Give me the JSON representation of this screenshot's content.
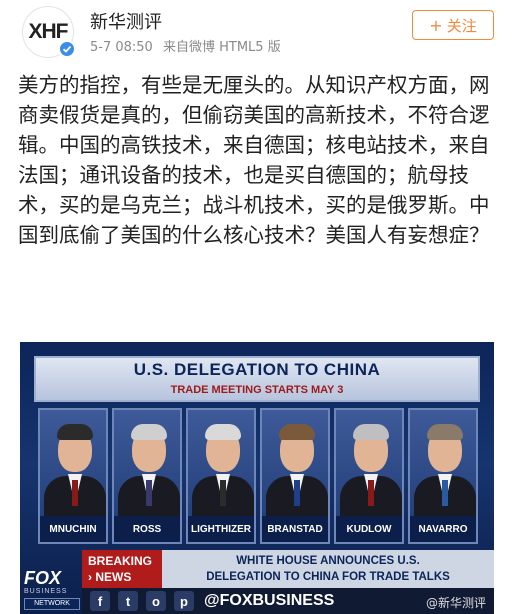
{
  "header": {
    "avatar_text": "XHF",
    "user_name": "新华测评",
    "post_time": "5-7 08:50",
    "post_source": "来自微博 HTML5 版",
    "follow_label": "关注",
    "follow_icon": "plus-icon"
  },
  "post": {
    "text": "美方的指控，有些是无厘头的。从知识产权方面，网商卖假货是真的，但偷窃美国的高新技术，不符合逻辑。中国的高铁技术，来自德国；核电站技术，来自法国；通讯设备的技术，也是买自德国的；航母技术，买的是乌克兰；战斗机技术，买的是俄罗斯。中国到底偷了美国的什么核心技术？美国人有妄想症？"
  },
  "news_image": {
    "banner_title": "U.S. DELEGATION TO CHINA",
    "banner_subtitle": "TRADE MEETING STARTS MAY 3",
    "delegates": [
      {
        "name": "MNUCHIN",
        "hair": "#2b2b2b",
        "tie": "#8a1a1a"
      },
      {
        "name": "ROSS",
        "hair": "#cfcfcf",
        "tie": "#3a3a6a"
      },
      {
        "name": "LIGHTHIZER",
        "hair": "#d9d9d9",
        "tie": "#2b2b2b"
      },
      {
        "name": "BRANSTAD",
        "hair": "#7a5a3a",
        "tie": "#1f3f8a"
      },
      {
        "name": "KUDLOW",
        "hair": "#bfbfbf",
        "tie": "#8a1a1a"
      },
      {
        "name": "NAVARRO",
        "hair": "#8a7a6a",
        "tie": "#2a5aa0"
      }
    ],
    "breaking_line1": "BREAKING",
    "breaking_line2": "› NEWS",
    "headline_line1": "WHITE HOUSE ANNOUNCES U.S.",
    "headline_line2": "DELEGATION TO CHINA FOR TRADE TALKS",
    "logo_text": "FOX",
    "logo_sub": "BUSINESS",
    "logo_network": "NETWORK",
    "social_icons": [
      "f",
      "t",
      "o",
      "p"
    ],
    "handle": "@FOXBUSINESS",
    "watermark": "@新华测评"
  },
  "colors": {
    "accent": "#f08a3c",
    "verified": "#3a8ee6",
    "breaking_red": "#b01c1c",
    "navy": "#0c2559"
  }
}
